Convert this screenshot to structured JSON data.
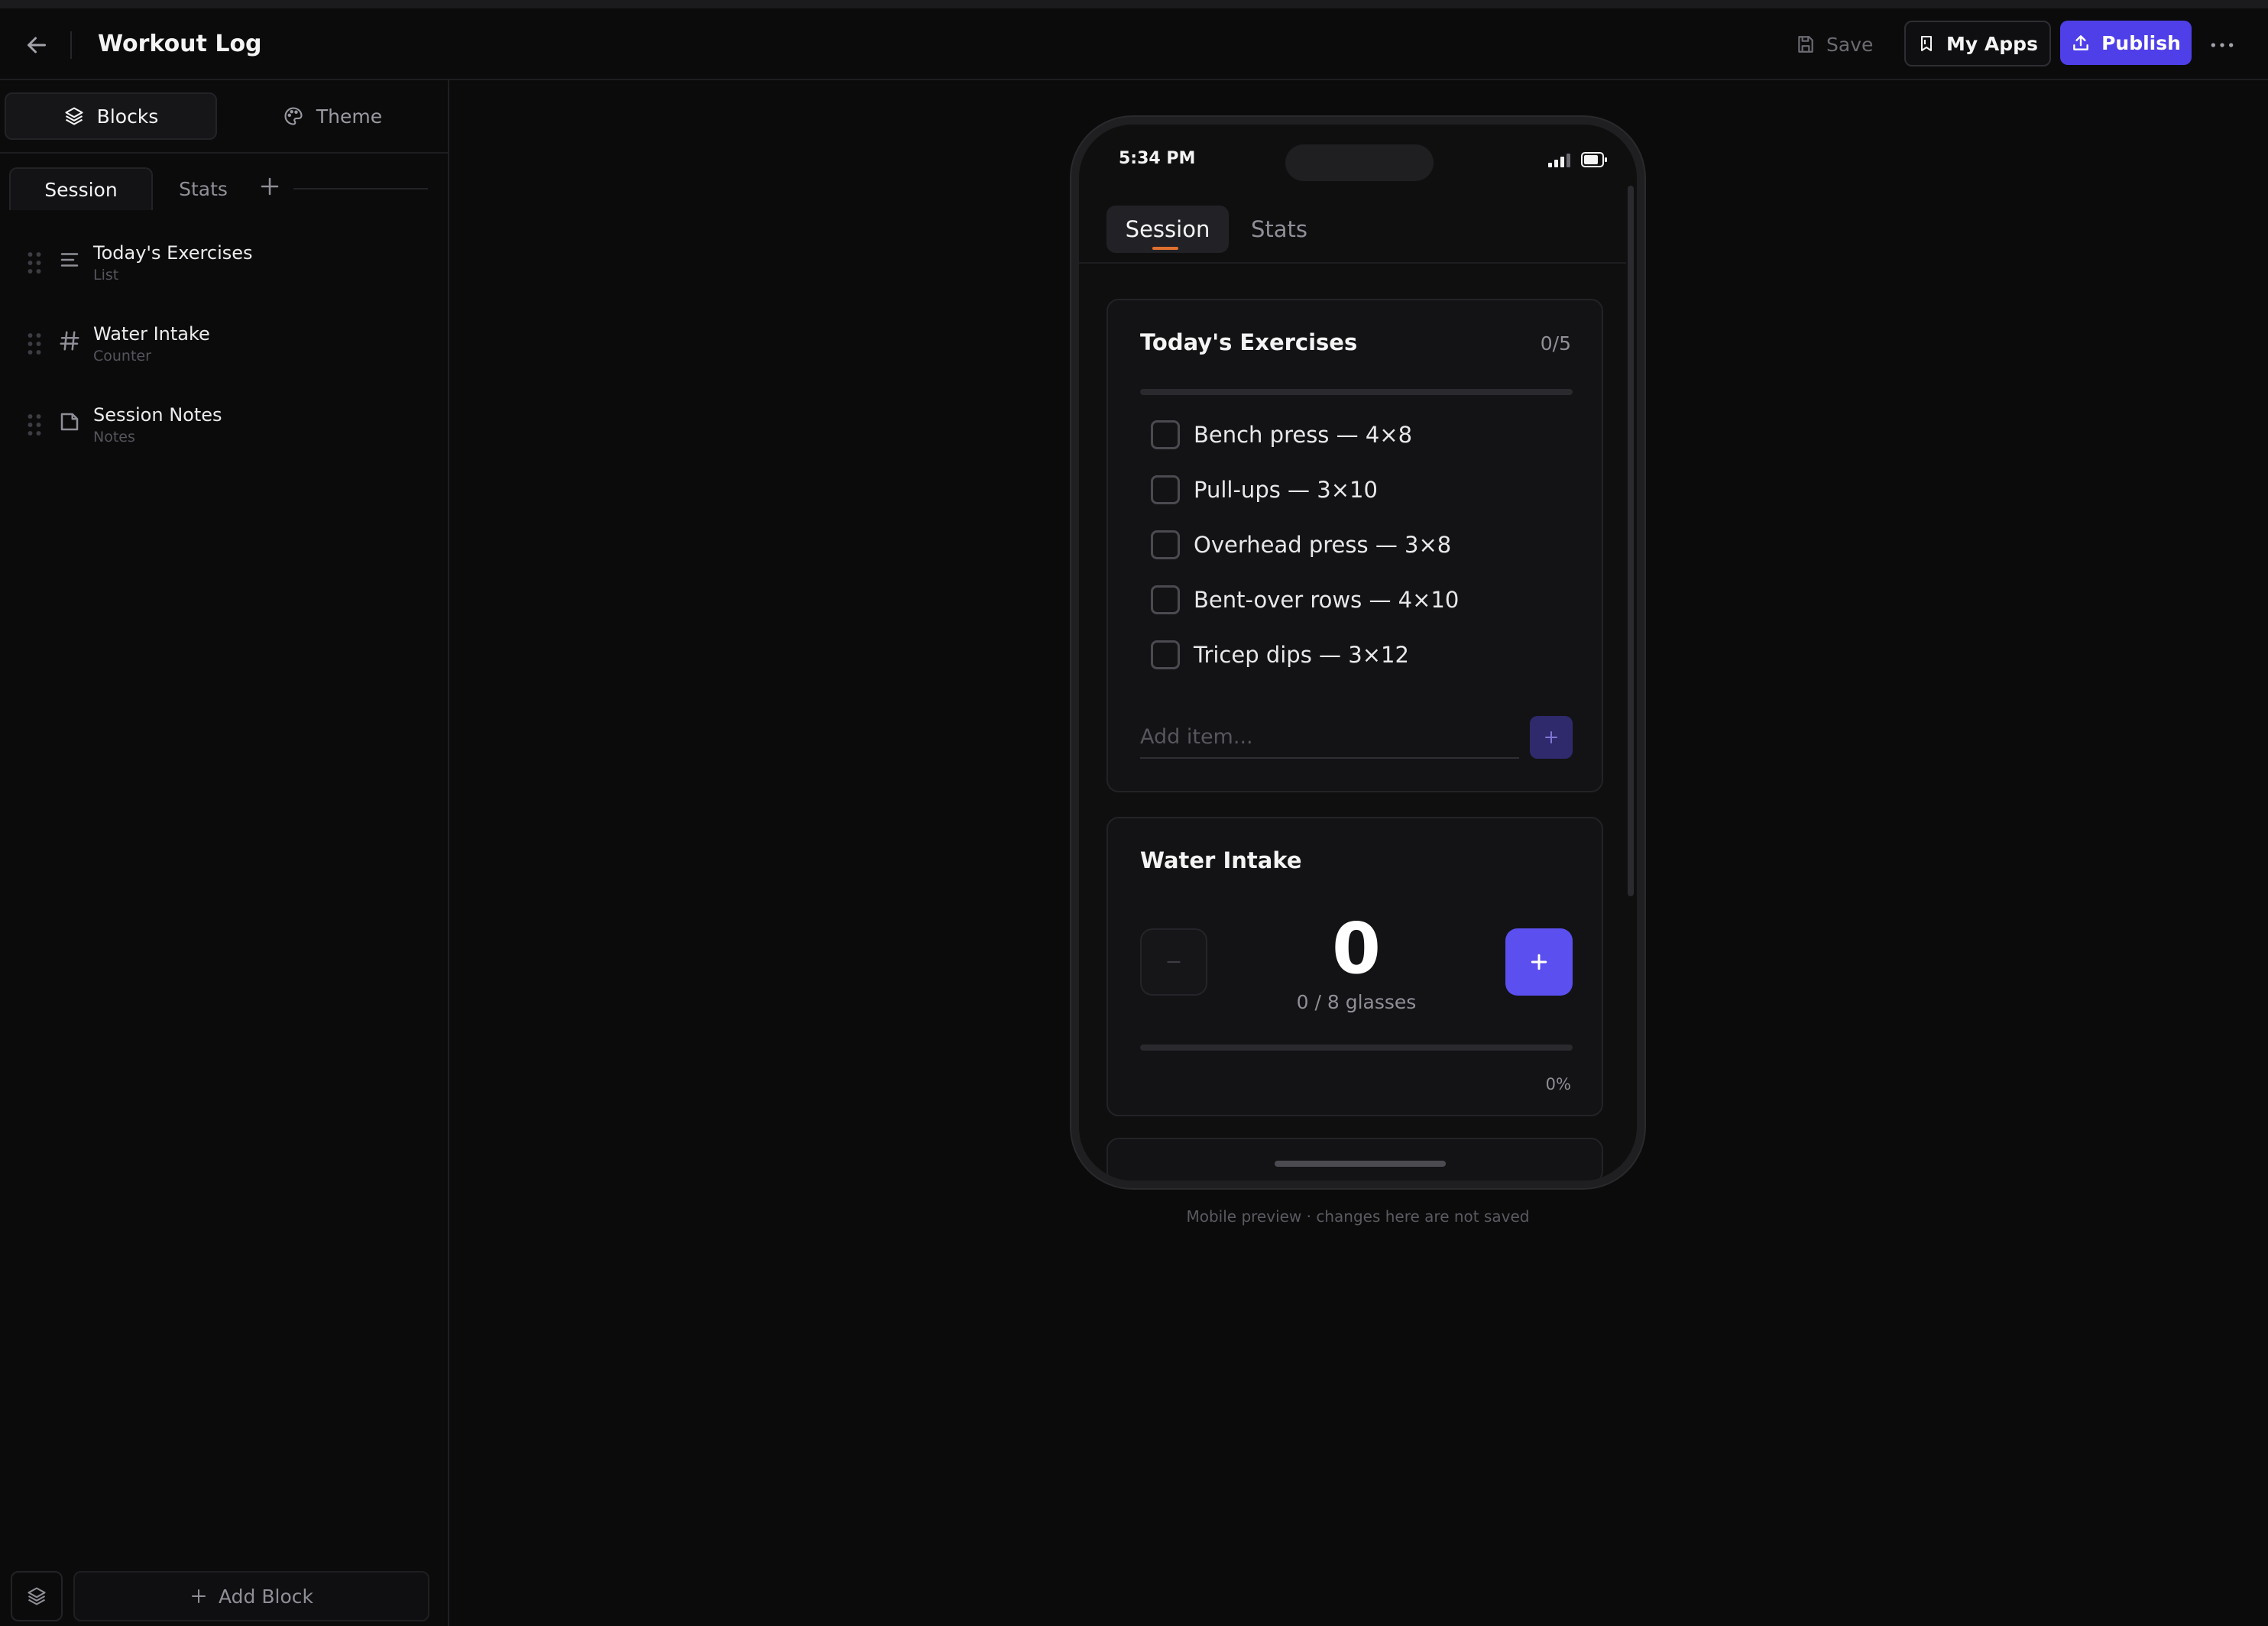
{
  "app": {
    "title": "Workout Log",
    "accent": "#4f3fe8"
  },
  "header": {
    "save_label": "Save",
    "myapps_label": "My Apps",
    "publish_label": "Publish"
  },
  "sidebar": {
    "tabs": [
      {
        "label": "Blocks",
        "icon": "layers-icon",
        "active": true
      },
      {
        "label": "Theme",
        "icon": "palette-icon",
        "active": false
      }
    ],
    "pages": [
      {
        "label": "Session",
        "active": true
      },
      {
        "label": "Stats",
        "active": false
      }
    ],
    "blocks": [
      {
        "name": "Today's Exercises",
        "type": "List",
        "icon": "list-icon"
      },
      {
        "name": "Water Intake",
        "type": "Counter",
        "icon": "hash-icon"
      },
      {
        "name": "Session Notes",
        "type": "Notes",
        "icon": "note-icon"
      }
    ],
    "add_block_label": "Add Block"
  },
  "phone": {
    "time": "5:34 PM",
    "tabs": [
      {
        "label": "Session",
        "active": true
      },
      {
        "label": "Stats",
        "active": false
      }
    ],
    "exercises": {
      "title": "Today's Exercises",
      "count": "0/5",
      "progress": 0,
      "items": [
        {
          "label": "Bench press — 4×8",
          "checked": false
        },
        {
          "label": "Pull-ups — 3×10",
          "checked": false
        },
        {
          "label": "Overhead press — 3×8",
          "checked": false
        },
        {
          "label": "Bent-over rows — 4×10",
          "checked": false
        },
        {
          "label": "Tricep dips — 3×12",
          "checked": false
        }
      ],
      "add_placeholder": "Add item..."
    },
    "water": {
      "title": "Water Intake",
      "value": "0",
      "subtitle": "0 / 8 glasses",
      "progress": 0,
      "percent_label": "0%"
    }
  },
  "preview_caption": "Mobile preview · changes here are not saved"
}
